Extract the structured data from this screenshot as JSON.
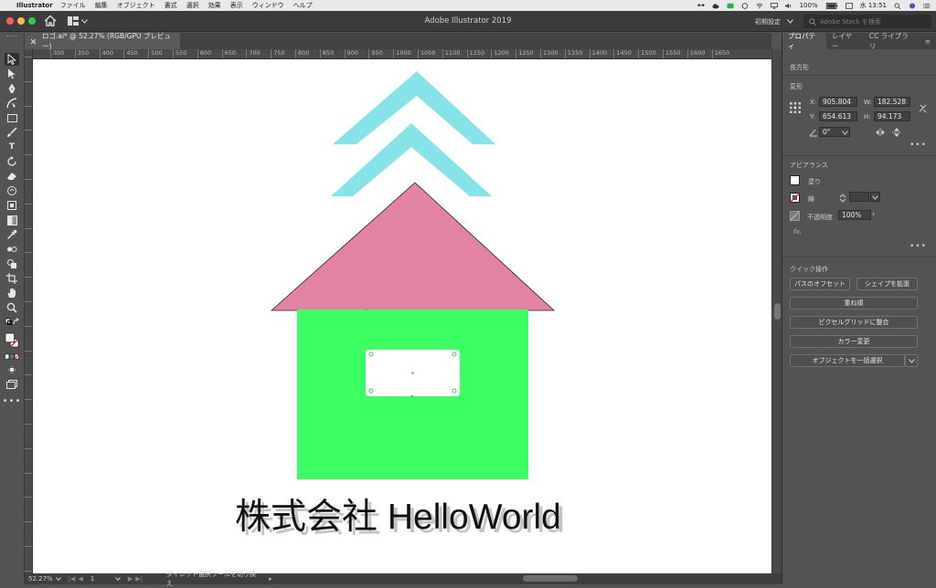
{
  "menubar": {
    "app_name": "Illustrator",
    "items": [
      "ファイル",
      "編集",
      "オブジェクト",
      "書式",
      "選択",
      "効果",
      "表示",
      "ウィンドウ",
      "ヘルプ"
    ],
    "battery": "100%",
    "clock": "水 13:51"
  },
  "titlebar": {
    "title": "Adobe Illustrator 2019",
    "workspace": "初期設定",
    "stock_search_placeholder": "Adobe Stock を検索"
  },
  "document": {
    "tab_label": "ロゴ.ai* @ 52.27% (RGB/GPU プレビュー)"
  },
  "ruler": {
    "top_ticks": [
      "300",
      "350",
      "400",
      "450",
      "500",
      "550",
      "600",
      "650",
      "700",
      "750",
      "800",
      "850",
      "900",
      "950",
      "1000",
      "1050",
      "1100",
      "1150",
      "1200",
      "1250",
      "1300",
      "1350",
      "1400",
      "1450",
      "1500",
      "1550",
      "1600",
      "1650"
    ]
  },
  "artwork": {
    "company_text": "株式会社 HelloWorld",
    "colors": {
      "chevron": "#86e3e8",
      "roof": "#e283a5",
      "body": "#3cff64",
      "window": "#ffffff",
      "text": "#111111",
      "text_shadow": "#c4c4c4"
    }
  },
  "statusbar": {
    "zoom": "52.27%",
    "page": "1",
    "tool_name": "ダイレクト選択ツールを切り換え"
  },
  "panel": {
    "tabs": [
      "プロパティ",
      "レイヤー",
      "CC ライブラリ"
    ],
    "object_type": "長方形",
    "transform": {
      "title": "変形",
      "x_label": "X:",
      "x_value": "905.804",
      "y_label": "Y:",
      "y_value": "654.613",
      "w_label": "W:",
      "w_value": "182.528",
      "h_label": "H:",
      "h_value": "94.173",
      "angle": "0°"
    },
    "appearance": {
      "title": "アピアランス",
      "fill_label": "塗り",
      "stroke_label": "線",
      "opacity_label": "不透明度",
      "opacity_value": "100%",
      "fx_label": "fx."
    },
    "quick_actions": {
      "title": "クイック操作",
      "offset_path": "パスのオフセット",
      "expand_shape": "シェイプを拡張",
      "arrange": "重ね順",
      "align_pixel": "ピクセルグリッドに整合",
      "recolor": "カラー変更",
      "select_same": "オブジェクトを一括選択"
    }
  }
}
